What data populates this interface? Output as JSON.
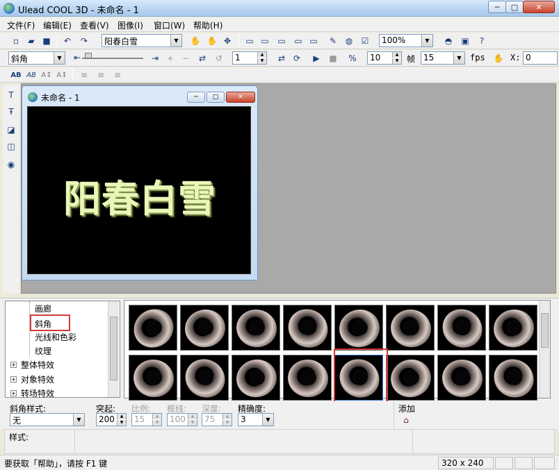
{
  "window": {
    "title": "Ulead COOL 3D - 未命名 - 1",
    "caption_min": "─",
    "caption_max": "□",
    "caption_close": "✕"
  },
  "menu": [
    "文件(F)",
    "编辑(E)",
    "查看(V)",
    "图像(I)",
    "窗口(W)",
    "帮助(H)"
  ],
  "toolbar1": {
    "text_combo": "阳春白雪",
    "zoom_combo": "100%"
  },
  "toolbar2": {
    "object_combo": "斜角",
    "frame_value": "1",
    "frames_total": "10",
    "frames_label": "帧",
    "fps_value": "15",
    "fps_label": "fps",
    "x_label": "X:",
    "x_value": "0"
  },
  "toolbar3": {
    "icons": [
      "AB",
      "AB",
      "A↕",
      "A↕"
    ]
  },
  "child_window": {
    "title": "未命名 - 1",
    "canvas_text": "阳春白雪"
  },
  "tree": {
    "items": [
      {
        "label": "画廊",
        "indent": 2
      },
      {
        "label": "斜角",
        "indent": 2
      },
      {
        "label": "光线和色彩",
        "indent": 2
      },
      {
        "label": "纹理",
        "indent": 2
      },
      {
        "label": "整体特效",
        "indent": 0
      },
      {
        "label": "对象特效",
        "indent": 0
      },
      {
        "label": "转场特效",
        "indent": 0
      }
    ]
  },
  "thumbnails": {
    "count": 16,
    "selected_index": 12
  },
  "params": {
    "bevel_style_label": "斜角样式:",
    "bevel_style_value": "无",
    "extrude_label": "突起:",
    "extrude_value": "200",
    "scale_label": "比例:",
    "scale_value": "15",
    "border_label": "框线:",
    "border_value": "100",
    "depth_label": "深度:",
    "depth_value": "75",
    "precision_label": "精确度:",
    "precision_value": "3",
    "add_label": "添加"
  },
  "style_bar": {
    "label": "样式:"
  },
  "status": {
    "help_text": "要获取「帮助」，请按 F1 键",
    "dimensions": "320 x 240"
  }
}
